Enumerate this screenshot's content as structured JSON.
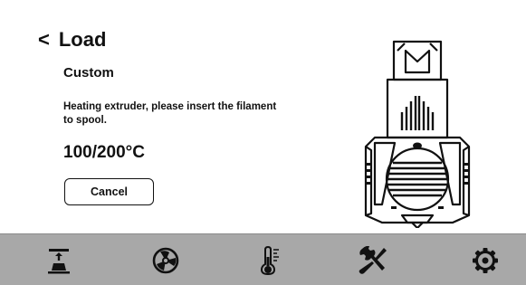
{
  "header": {
    "back_icon": "chevron-left-icon",
    "back_glyph": "<",
    "title": "Load"
  },
  "content": {
    "profile": "Custom",
    "message": "Heating extruder, please insert the filament to spool.",
    "temperature": "100/200°C",
    "cancel_label": "Cancel"
  },
  "illustration": {
    "icon": "extruder-hotend-icon"
  },
  "navbar": {
    "background": "#a8a8a8",
    "items": [
      {
        "icon": "print-bed-icon"
      },
      {
        "icon": "fan-icon"
      },
      {
        "icon": "thermometer-icon"
      },
      {
        "icon": "tools-icon"
      },
      {
        "icon": "settings-gear-icon"
      }
    ]
  }
}
